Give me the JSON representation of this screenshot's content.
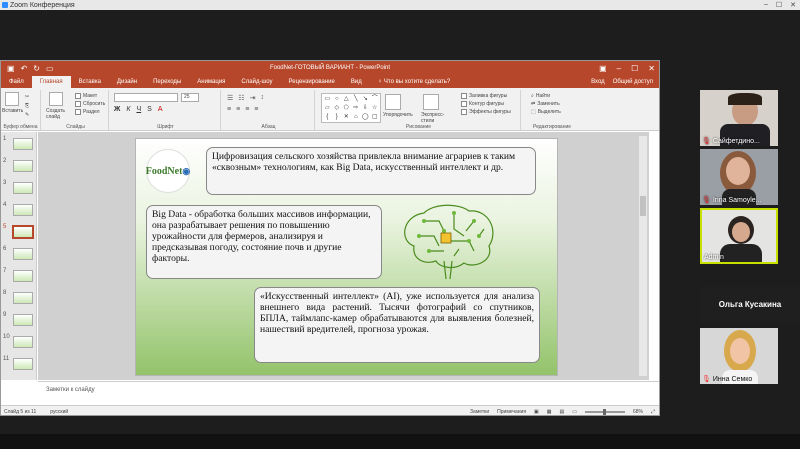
{
  "zoom": {
    "title": "Zoom Конференция"
  },
  "ppt": {
    "title": "FoodNet-ГОТОВЫЙ ВАРИАНТ - PowerPoint",
    "tabs": [
      "Файл",
      "Главная",
      "Вставка",
      "Дизайн",
      "Переходы",
      "Анимация",
      "Слайд-шоу",
      "Рецензирование",
      "Вид"
    ],
    "tell_me": "Что вы хотите сделать?",
    "sign_in": "Вход",
    "share": "Общий доступ",
    "ribbon": {
      "paste": "Вставить",
      "clipboard": "Буфер обмена",
      "new_slide": "Создать слайд",
      "layout": "Макет",
      "reset": "Сбросить",
      "section": "Раздел",
      "slides": "Слайды",
      "font_size": "25",
      "font": "Шрифт",
      "paragraph": "Абзац",
      "arrange": "Упорядочить",
      "quick_styles": "Экспресс-стили",
      "fill": "Заливка фигуры",
      "outline": "Контур фигуры",
      "effects": "Эффекты фигуры",
      "drawing": "Рисование",
      "find": "Найти",
      "replace": "Заменить",
      "select": "Выделить",
      "editing": "Редактирование"
    },
    "thumbs": [
      "1",
      "2",
      "3",
      "4",
      "5",
      "6",
      "7",
      "8",
      "9",
      "10",
      "11"
    ],
    "slide": {
      "logo": "FoodNet",
      "box1": "Цифровизация сельского хозяйства привлекла внимание аграриев к таким «сквозным» технологиям, как Big Data, искусственный интеллект и др.",
      "box2": "Big Data - обработка больших массивов информации, она разрабатывает решения по повышению урожайности для фермеров, анализируя и предсказывая погоду, состояние почв и другие факторы.",
      "box3": "«Искусственный интеллект» (AI), уже используется для анализа внешнего вида растений. Тысячи фотографий со спутников, БПЛА, таймлапс-камер обрабатываются для выявления болезней, нашествий вредителей, прогноза урожая."
    },
    "notes": "Заметки к слайду",
    "status": {
      "slide": "Слайд 5 из 11",
      "lang": "русский",
      "notes": "Заметки",
      "comments": "Примечания",
      "zoom": "68%"
    }
  },
  "participants": [
    {
      "name": "Сайфетдино..."
    },
    {
      "name": "Irina Samoyle..."
    },
    {
      "name": "Admin"
    },
    {
      "name": "Ольга Кусакина"
    },
    {
      "name": "Инна Семко"
    }
  ]
}
